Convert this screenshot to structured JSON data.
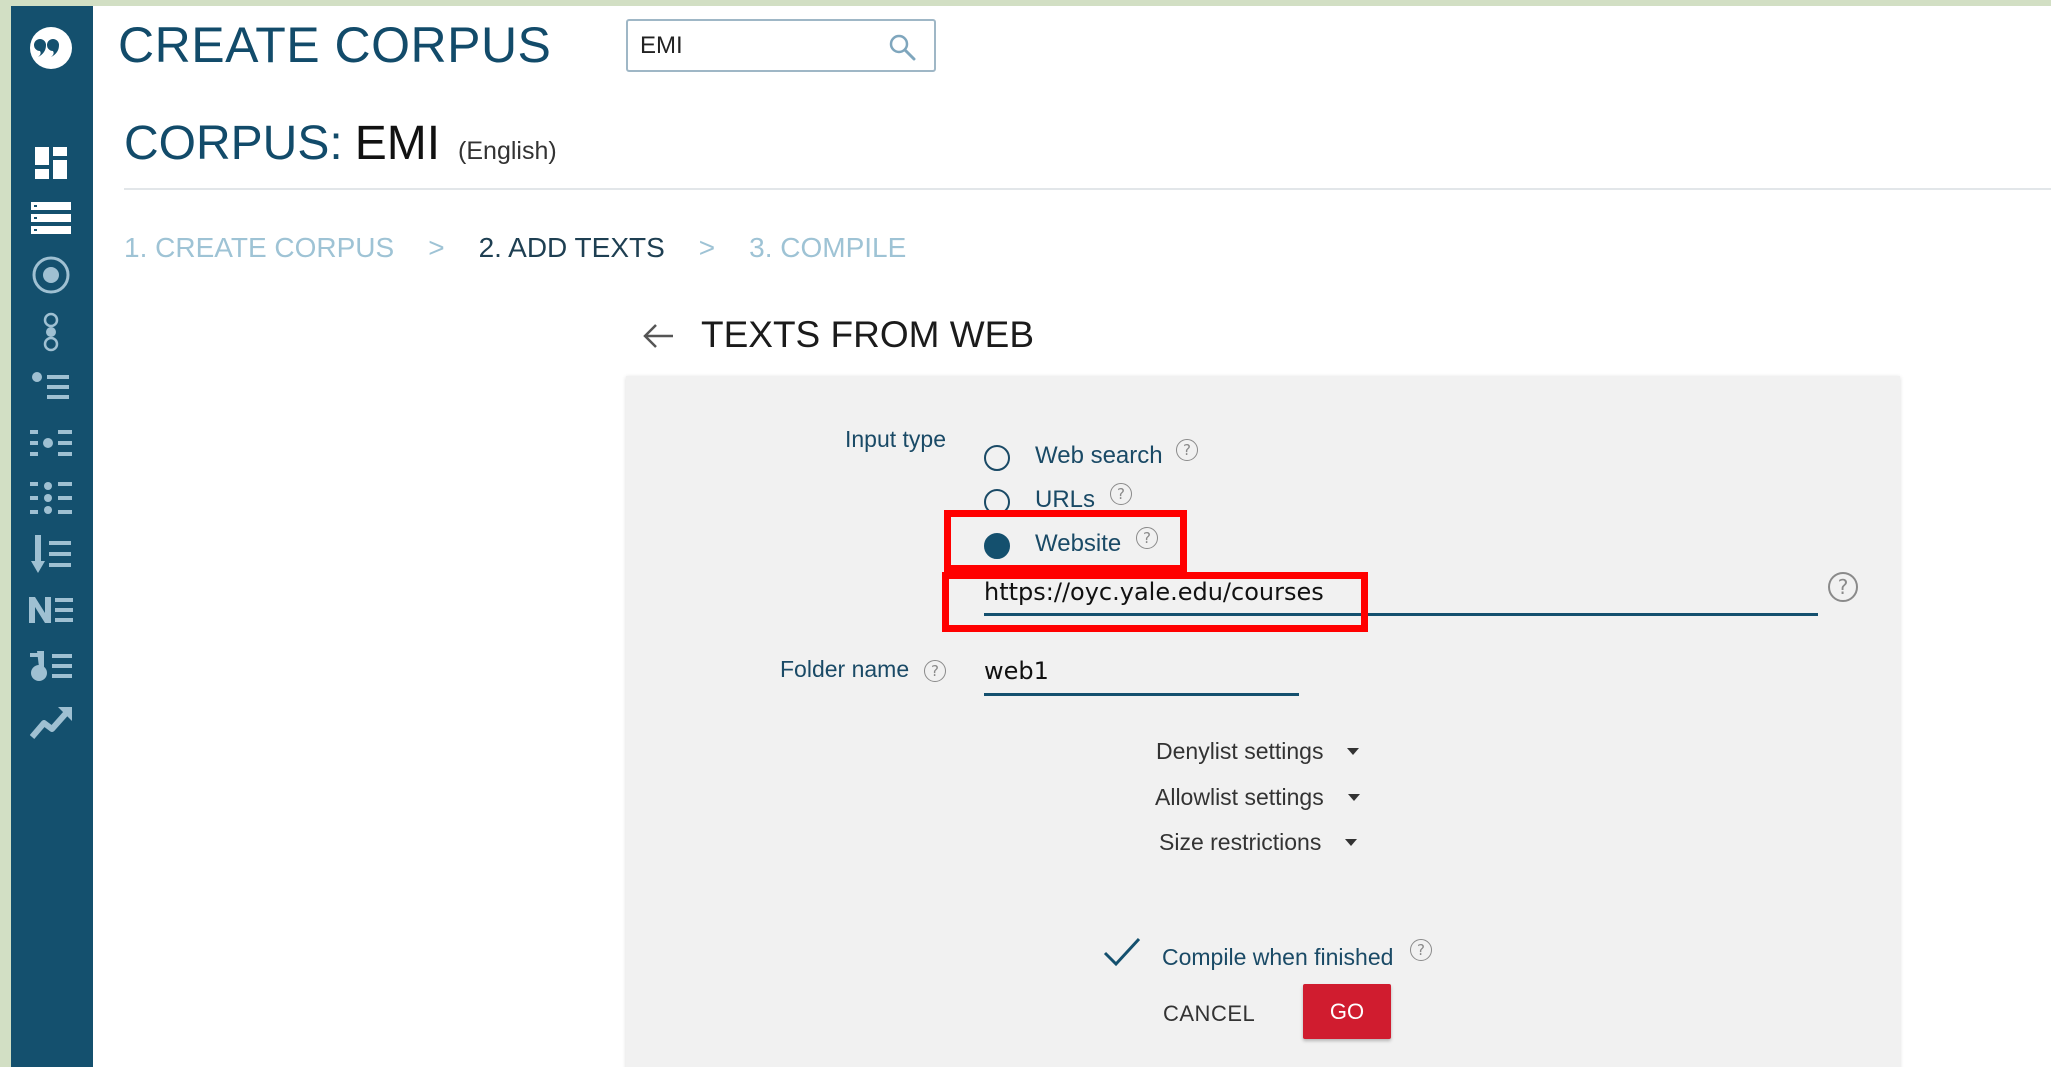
{
  "header": {
    "title": "CREATE CORPUS",
    "search": {
      "value": "EMI",
      "placeholder": ""
    }
  },
  "corpus": {
    "label": "CORPUS:",
    "name": "EMI",
    "language": "(English)"
  },
  "breadcrumb": {
    "steps": [
      "1. CREATE CORPUS",
      "2. ADD TEXTS",
      "3. COMPILE"
    ],
    "separator": ">",
    "active_index": 1
  },
  "section": {
    "title": "TEXTS FROM WEB"
  },
  "form": {
    "input_type_label": "Input type",
    "options": [
      {
        "label": "Web search",
        "checked": false
      },
      {
        "label": "URLs",
        "checked": false
      },
      {
        "label": "Website",
        "checked": true
      }
    ],
    "website_url": "https://oyc.yale.edu/courses",
    "folder_label": "Folder name",
    "folder_value": "web1",
    "dropdowns": [
      "Denylist settings",
      "Allowlist settings",
      "Size restrictions"
    ],
    "compile_label": "Compile when finished",
    "compile_checked": true,
    "help_glyph": "?",
    "cancel_label": "CANCEL",
    "go_label": "GO"
  },
  "sidebar": {
    "icons": [
      "logo-icon",
      "dashboard-icon",
      "list-icon",
      "target-icon",
      "concordance-icon",
      "bullet-list-icon",
      "dots-list-icon",
      "grid-list-icon",
      "sort-list-icon",
      "ngram-icon",
      "keyword-icon",
      "trend-icon"
    ]
  },
  "colors": {
    "sidebar": "#14506e",
    "accent": "#124b6a",
    "highlight": "#ff0000",
    "go_button": "#d01c2f",
    "background": "#d2dfc4"
  }
}
